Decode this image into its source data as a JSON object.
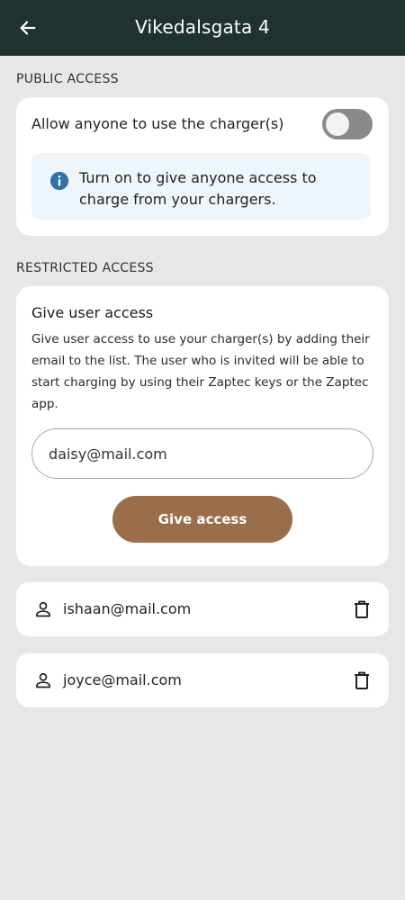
{
  "header": {
    "title": "Vikedalsgata 4",
    "back_icon": "arrow-left-icon"
  },
  "colors": {
    "header_bg": "#1e3330",
    "page_bg": "#e6e7e6",
    "accent_button": "#9a6e4b",
    "info_bg": "#eef6fb",
    "info_icon": "#2f73a8"
  },
  "public_access": {
    "section_label": "PUBLIC ACCESS",
    "toggle_label": "Allow anyone to use the charger(s)",
    "toggle_on": false,
    "info_icon": "info-icon",
    "info_text": "Turn on to give anyone access to charge from your chargers."
  },
  "restricted_access": {
    "section_label": "RESTRICTED ACCESS",
    "card_title": "Give user access",
    "description": "Give user access to use your charger(s) by adding their email to the list. The user who is invited will be able to start charging by using their Zaptec keys or the Zaptec app.",
    "email_value": "daisy@mail.com",
    "button_label": "Give access"
  },
  "users": [
    {
      "email": "ishaan@mail.com",
      "icon": "person-icon",
      "action_icon": "trash-icon"
    },
    {
      "email": "joyce@mail.com",
      "icon": "person-icon",
      "action_icon": "trash-icon"
    }
  ]
}
